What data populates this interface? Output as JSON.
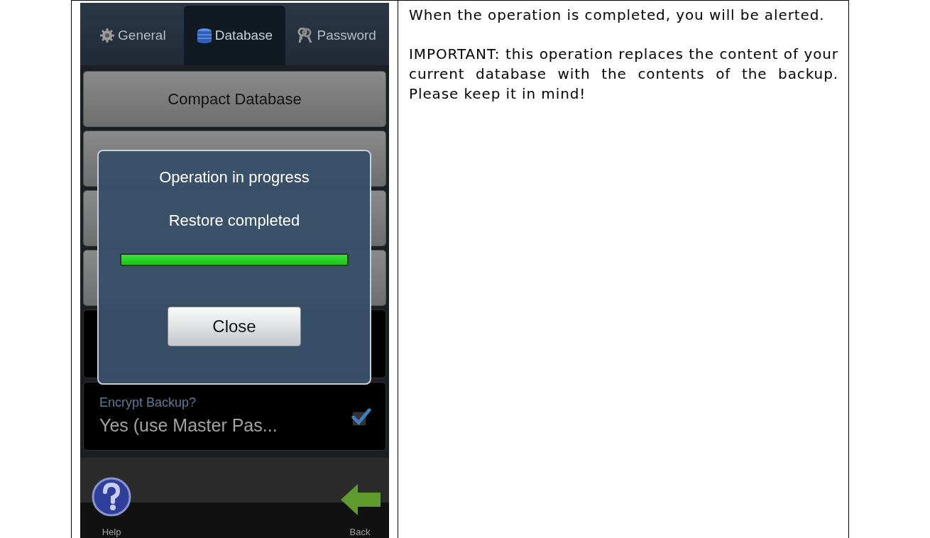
{
  "phone_screen": {
    "tabs": [
      {
        "label": "General",
        "kind": "gear",
        "selected": false
      },
      {
        "label": "Database",
        "kind": "database",
        "selected": true
      },
      {
        "label": "Password",
        "kind": "keys",
        "selected": false
      }
    ],
    "menu_buttons": [
      {
        "label": "Compact Database"
      }
    ],
    "settings": [
      {
        "label": "Encrypt Backup?",
        "value": "Yes (use Master Pas...",
        "checked": true
      }
    ],
    "dialog": {
      "title": "Operation in progress",
      "message": "Restore completed",
      "level": 1,
      "button": "Close"
    },
    "bottom_bar": [
      {
        "kind": "help",
        "label": "Help"
      },
      {
        "kind": "back",
        "label": "Back"
      }
    ]
  },
  "description": [
    "When the operation is completed, you will be alerted.",
    "IMPORTANT: this operation replaces the content of your current database with the contents of the backup. Please keep it in mind!"
  ]
}
